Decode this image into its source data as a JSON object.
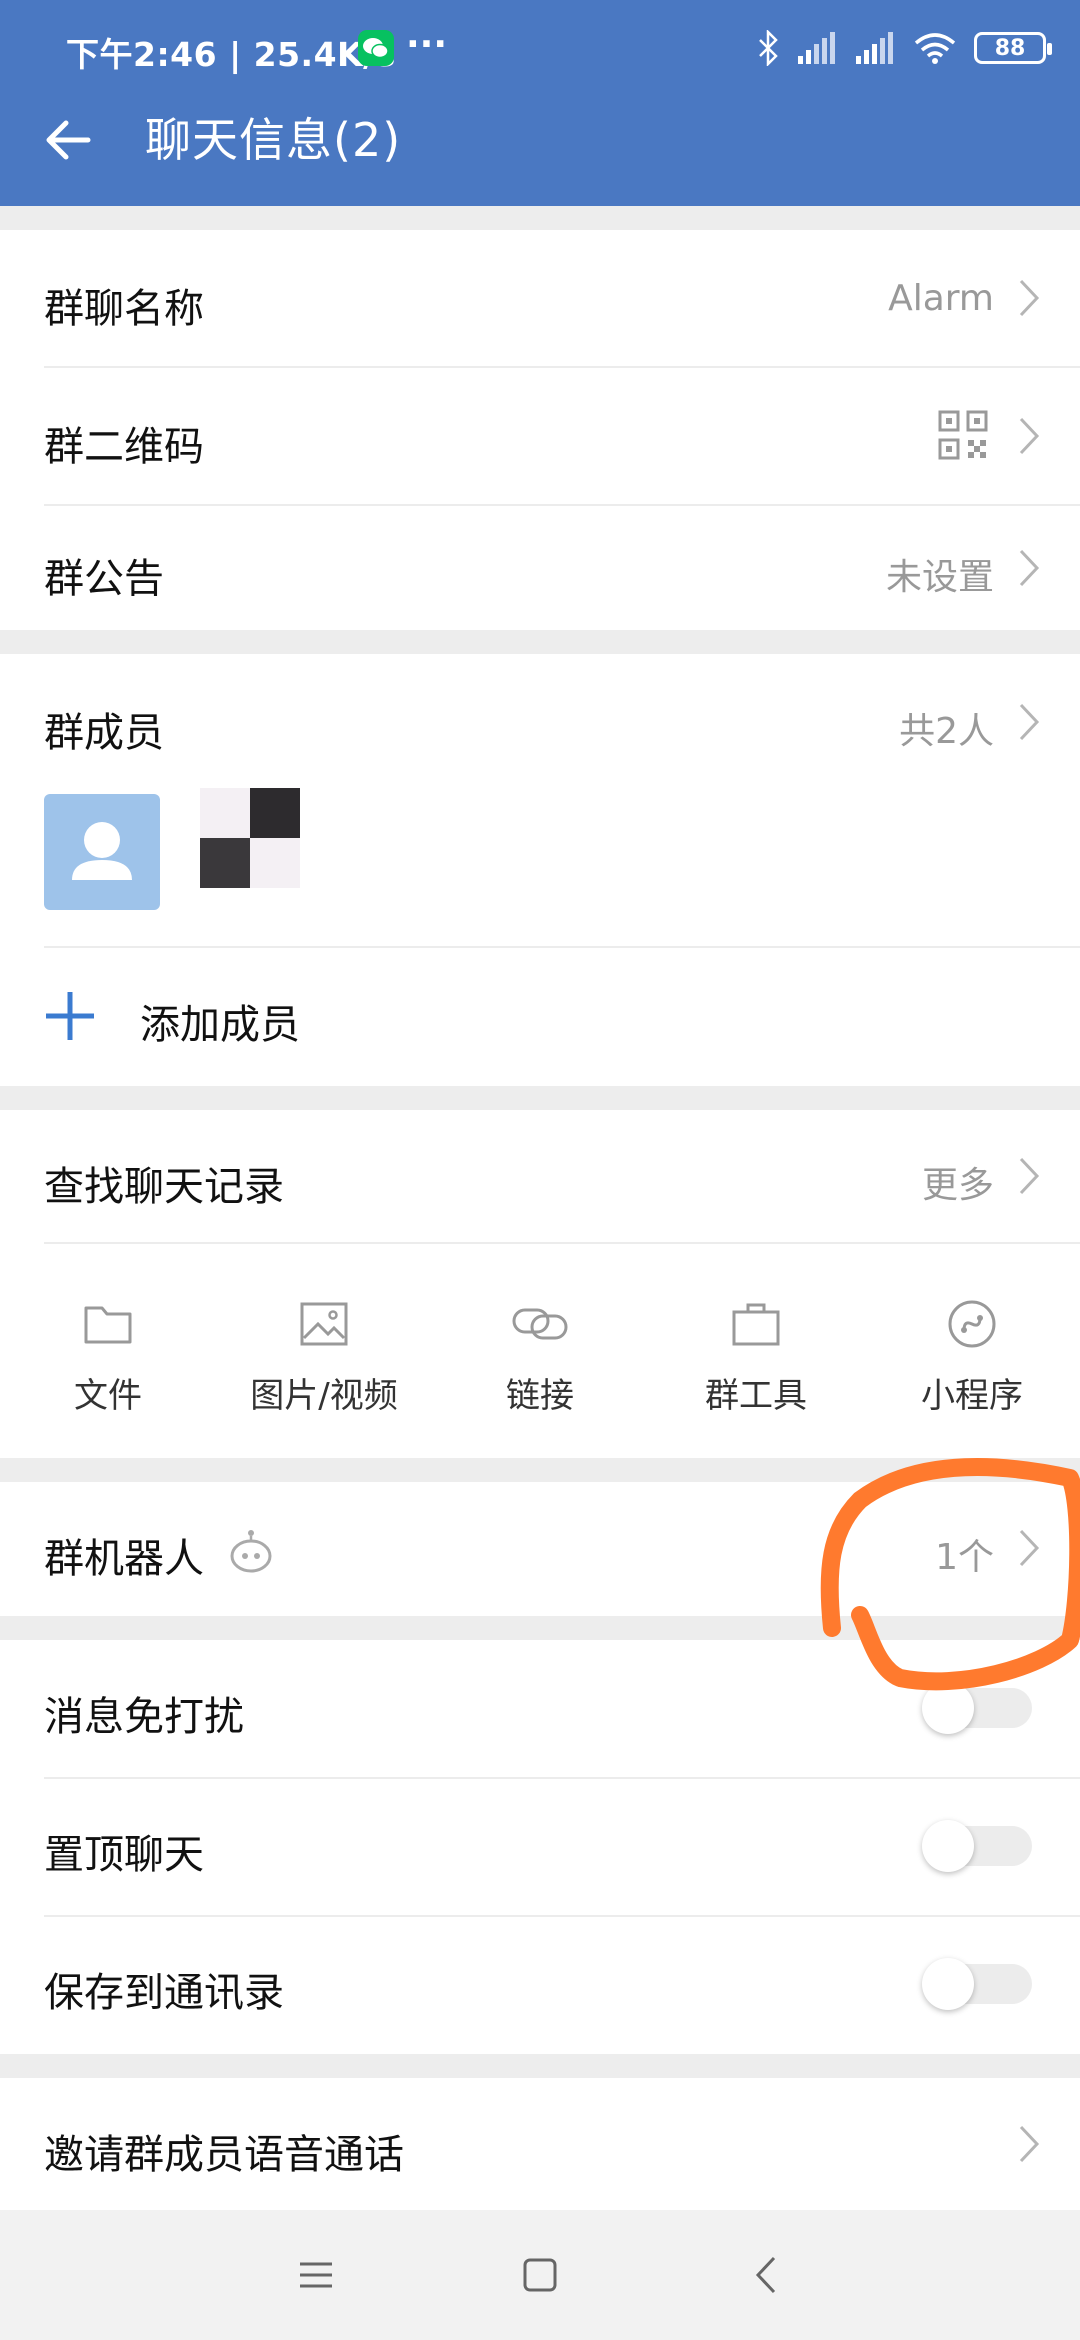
{
  "status_bar": {
    "time_speed": "下午2:46 | 25.4K/s",
    "more": "···",
    "battery": "88"
  },
  "header": {
    "title": "聊天信息(2)"
  },
  "info": {
    "group_name_label": "群聊名称",
    "group_name_value": "Alarm",
    "qr_label": "群二维码",
    "notice_label": "群公告",
    "notice_value": "未设置"
  },
  "members": {
    "label": "群成员",
    "count": "共2人",
    "add_label": "添加成员"
  },
  "history": {
    "label": "查找聊天记录",
    "more": "更多",
    "tools": [
      {
        "label": "文件",
        "icon": "folder-icon"
      },
      {
        "label": "图片/视频",
        "icon": "image-icon"
      },
      {
        "label": "链接",
        "icon": "link-icon"
      },
      {
        "label": "群工具",
        "icon": "toolbox-icon"
      },
      {
        "label": "小程序",
        "icon": "mini-program-icon"
      }
    ]
  },
  "robot": {
    "label": "群机器人",
    "value": "1个"
  },
  "settings": {
    "mute": {
      "label": "消息免打扰",
      "on": false
    },
    "pin": {
      "label": "置顶聊天",
      "on": false
    },
    "save": {
      "label": "保存到通讯录",
      "on": false
    }
  },
  "voice_call": {
    "label": "邀请群成员语音通话"
  },
  "colors": {
    "header": "#4a78c2",
    "accent": "#3b7bd0",
    "annotation": "#ff7a2e"
  }
}
